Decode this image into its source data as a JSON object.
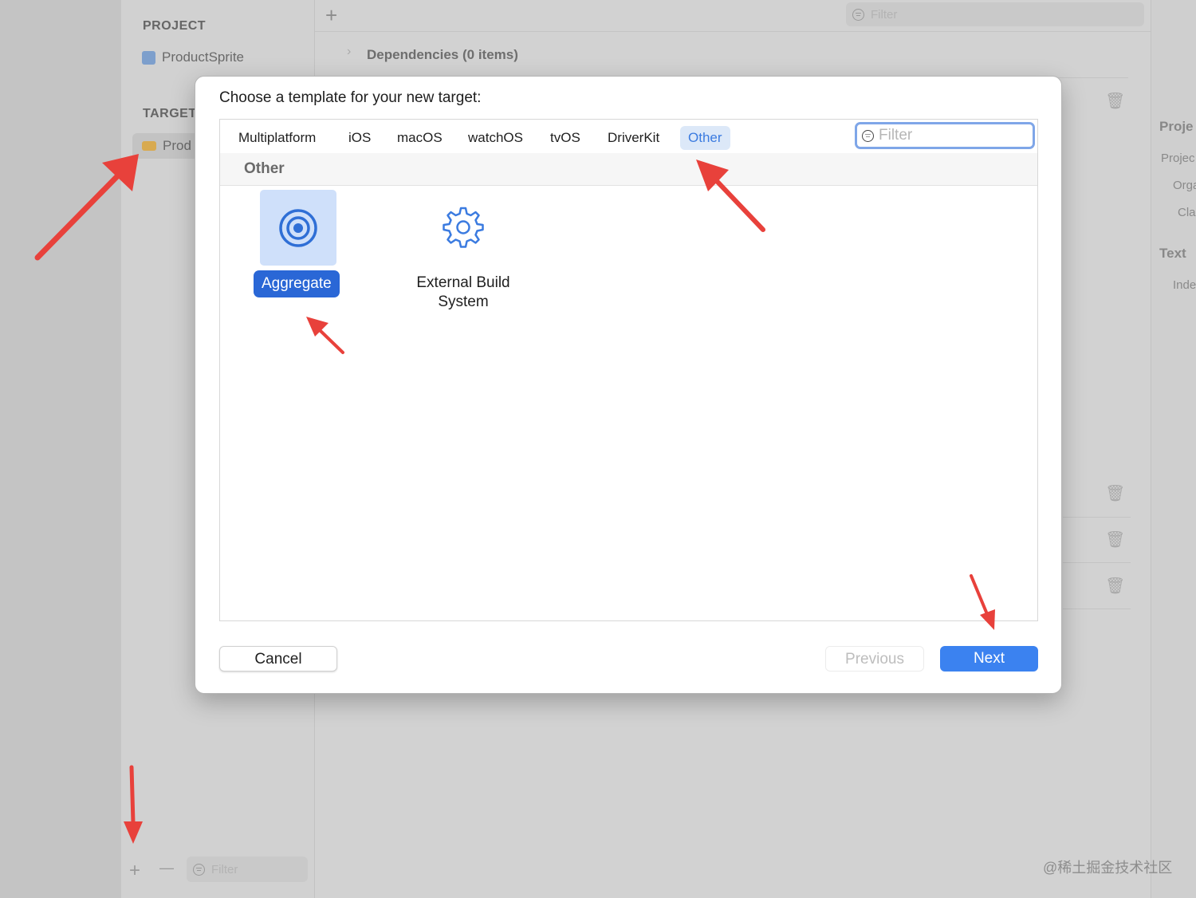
{
  "navigator": {
    "project_header": "PROJECT",
    "project_item": "ProductSprite",
    "targets_header": "TARGET",
    "target_item": "Prod",
    "filter_placeholder": "Filter",
    "add_symbol": "+",
    "remove_symbol": "—"
  },
  "editor": {
    "add_symbol": "+",
    "filter_placeholder": "Filter",
    "dependencies_label": "Dependencies (0 items)"
  },
  "inspector": {
    "heading1": "Proje",
    "item1": "Projec",
    "item2": "Orga",
    "item3": "Cla",
    "heading2": "Text",
    "item4": "Inde"
  },
  "dialog": {
    "title": "Choose a template for your new target:",
    "tabs": [
      "Multiplatform",
      "iOS",
      "macOS",
      "watchOS",
      "tvOS",
      "DriverKit",
      "Other"
    ],
    "active_tab": "Other",
    "filter_placeholder": "Filter",
    "section_label": "Other",
    "templates": [
      {
        "label": "Aggregate",
        "icon": "target-icon",
        "selected": true
      },
      {
        "label": "External Build System",
        "icon": "gear-icon",
        "selected": false
      }
    ],
    "buttons": {
      "cancel": "Cancel",
      "previous": "Previous",
      "next": "Next"
    }
  },
  "watermark": "@稀土掘金技术社区",
  "colors": {
    "accent": "#3b82f0",
    "selection": "#2a67d6",
    "annotation_arrow": "#e8413b"
  }
}
